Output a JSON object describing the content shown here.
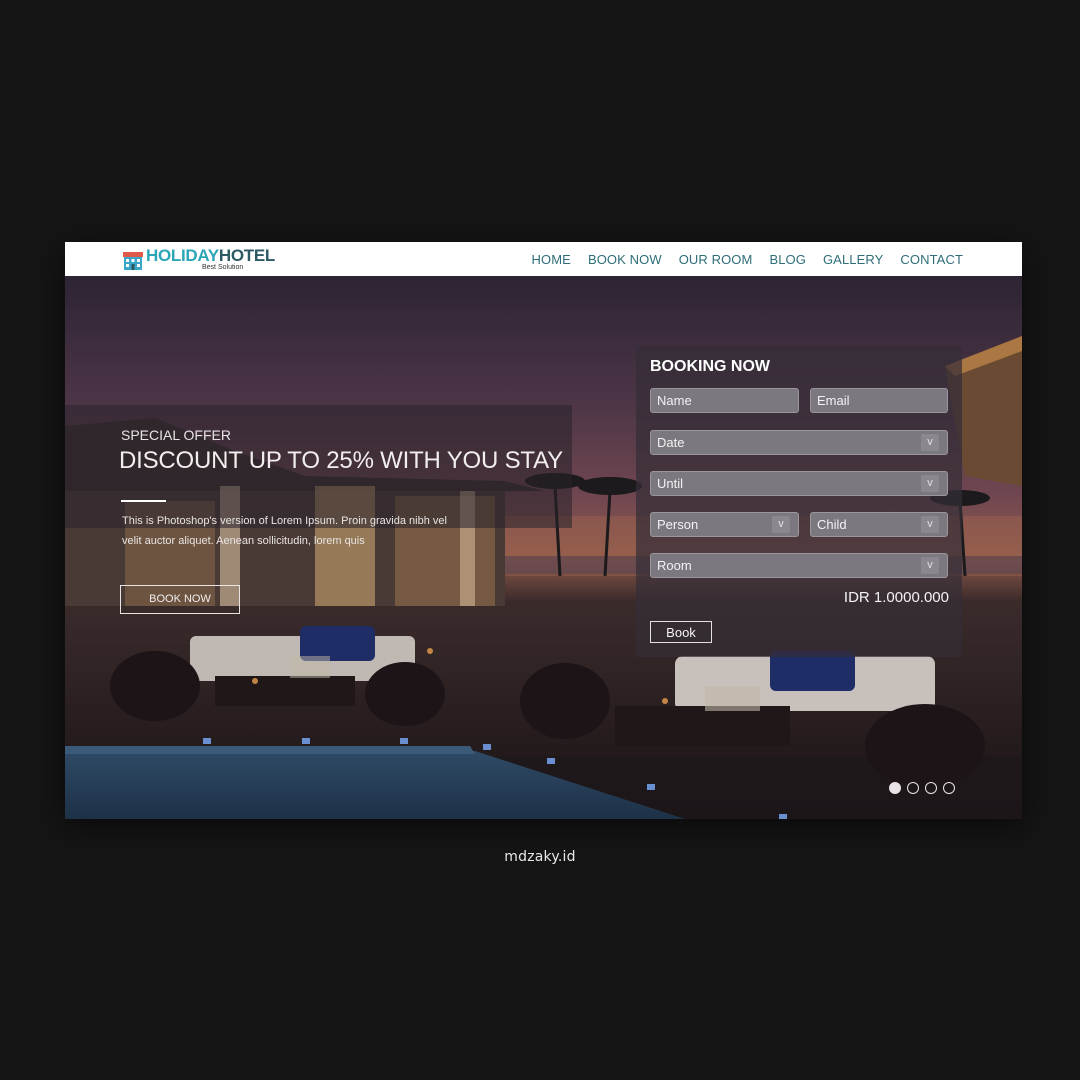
{
  "brand": {
    "name_part1": "HOLIDAY",
    "name_part2": "HOTEL",
    "tagline": "Best Solution",
    "colors": {
      "holiday": "#2aa6b7",
      "hotel": "#2c5a63",
      "nav": "#2e6e78"
    }
  },
  "nav": {
    "items": [
      {
        "label": "HOME"
      },
      {
        "label": "BOOK NOW"
      },
      {
        "label": "OUR ROOM"
      },
      {
        "label": "BLOG"
      },
      {
        "label": "GALLERY"
      },
      {
        "label": "CONTACT"
      }
    ]
  },
  "offer": {
    "subtitle": "SPECIAL OFFER",
    "title": "DISCOUNT UP TO 25% WITH YOU STAY",
    "description": "This is Photoshop's version  of Lorem Ipsum. Proin gravida nibh vel velit auctor aliquet. Aenean sollicitudin, lorem quis",
    "button_label": "BOOK NOW"
  },
  "booking": {
    "title": "BOOKING NOW",
    "name_placeholder": "Name",
    "email_placeholder": "Email",
    "date_label": "Date",
    "until_label": "Until",
    "person_label": "Person",
    "child_label": "Child",
    "room_label": "Room",
    "caret": "v",
    "price": "IDR 1.0000.000",
    "book_label": "Book"
  },
  "slider": {
    "total": 4,
    "active": 1
  },
  "credit": "mdzaky.id"
}
